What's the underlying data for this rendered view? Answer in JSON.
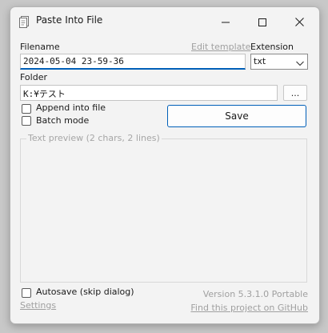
{
  "window": {
    "title": "Paste Into File",
    "minimize_icon": "minimize-icon",
    "maximize_icon": "maximize-icon",
    "close_icon": "close-icon"
  },
  "filename": {
    "label": "Filename",
    "value": "2024-05-04 23-59-36",
    "edit_template_link": "Edit template"
  },
  "extension": {
    "label": "Extension",
    "value": "txt"
  },
  "folder": {
    "label": "Folder",
    "value": "K:¥テスト",
    "browse_label": "..."
  },
  "options": {
    "append_label": "Append into file",
    "batch_label": "Batch mode",
    "autosave_label": "Autosave (skip dialog)"
  },
  "save_button": "Save",
  "preview": {
    "legend": "Text preview (2 chars, 2 lines)"
  },
  "footer": {
    "settings_link": "Settings",
    "version": "Version 5.3.1.0 Portable",
    "github_link": "Find this project on GitHub"
  },
  "colors": {
    "accent": "#005fb8",
    "window_bg": "#f3f3f3"
  }
}
